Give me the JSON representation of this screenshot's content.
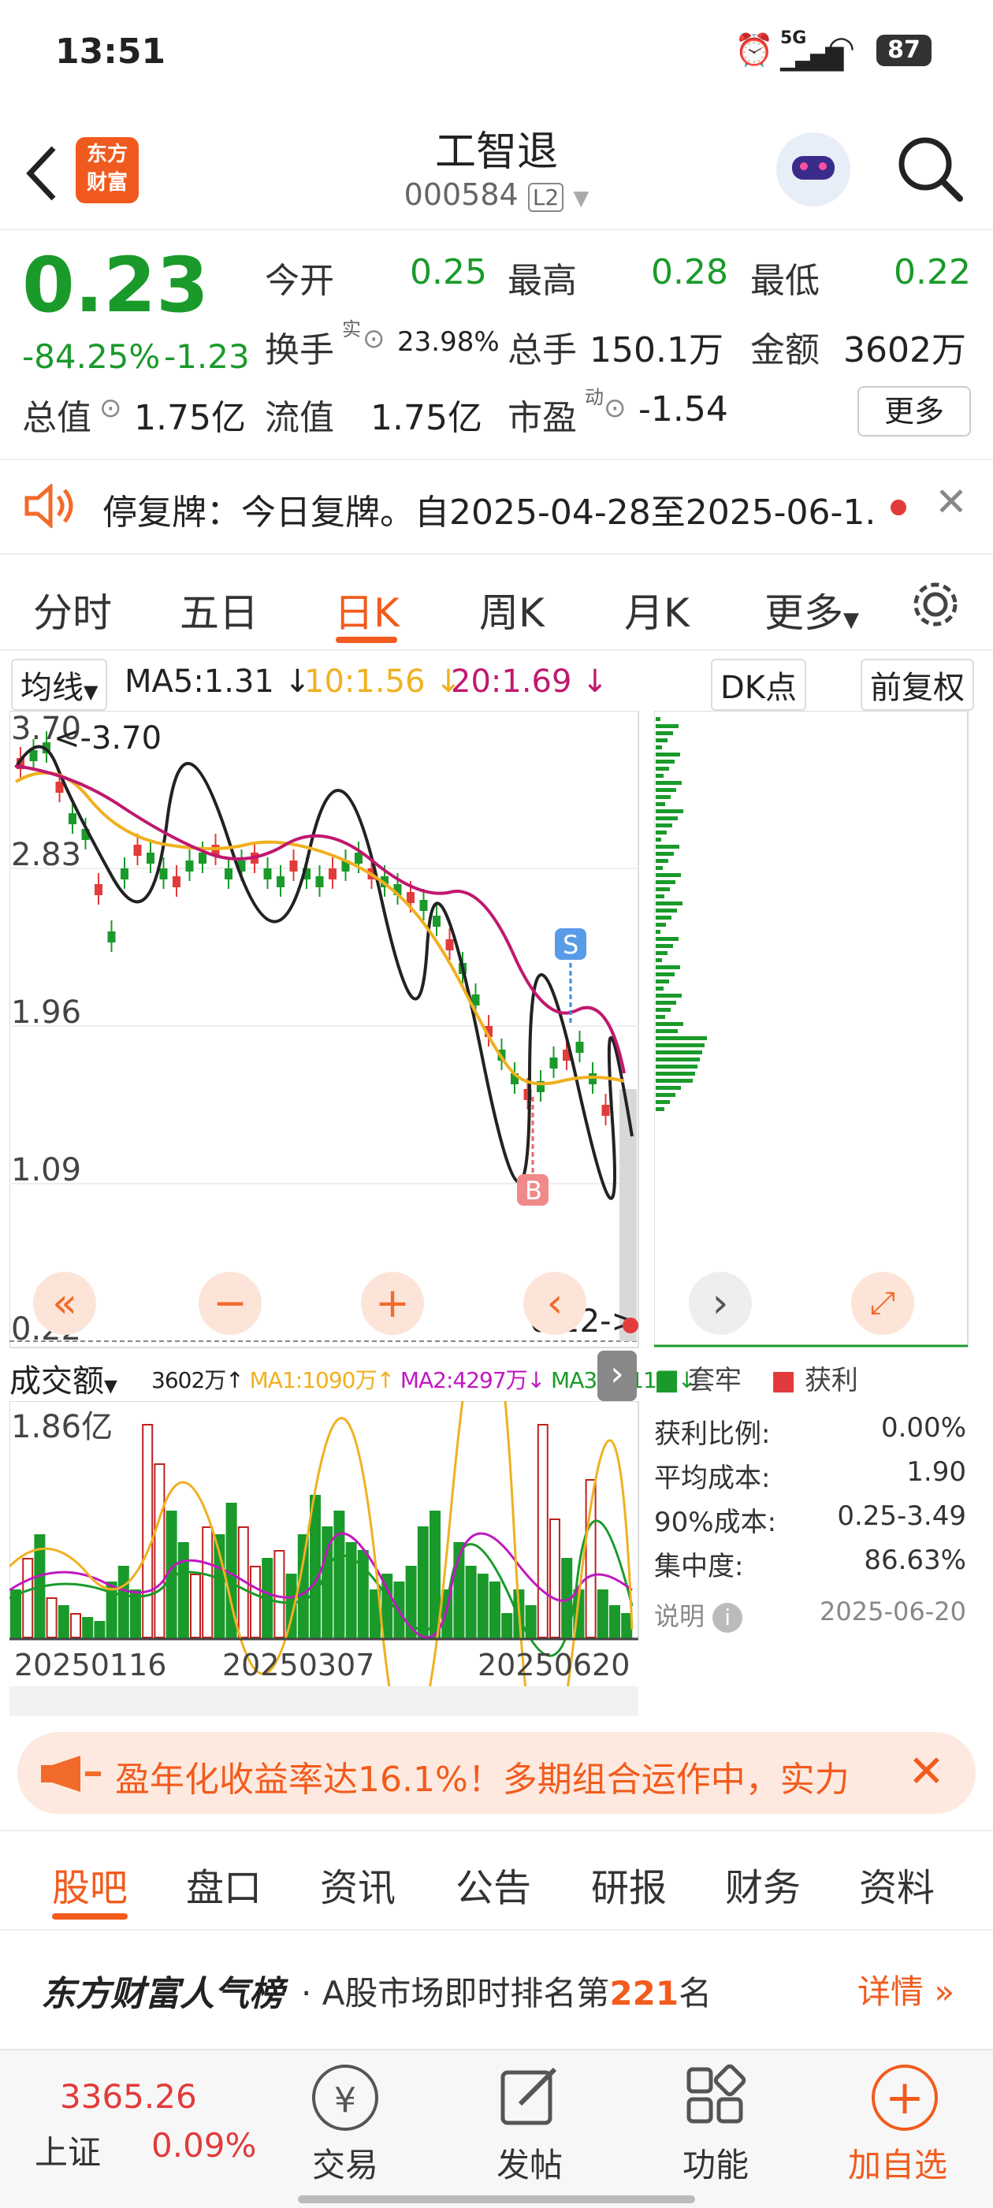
{
  "status": {
    "time": "13:51",
    "signal": "5G",
    "battery": "87"
  },
  "header": {
    "title": "工智退",
    "code": "000584",
    "level": "L2",
    "logo_line1": "东方",
    "logo_line2": "财富"
  },
  "quote": {
    "price": "0.23",
    "change_pct": "-84.25%",
    "change": "-1.23",
    "open_label": "今开",
    "open": "0.25",
    "high_label": "最高",
    "high": "0.28",
    "low_label": "最低",
    "low": "0.22",
    "turnover_label": "换手",
    "turnover_sup": "实",
    "turnover": "23.98%",
    "volume_label": "总手",
    "volume": "150.1万",
    "amount_label": "金额",
    "amount": "3602万",
    "mktcap_label": "总值",
    "mktcap": "1.75亿",
    "float_label": "流值",
    "float": "1.75亿",
    "pe_label": "市盈",
    "pe_sup": "动",
    "pe": "-1.54",
    "more": "更多"
  },
  "notice": {
    "text": "停复牌：今日复牌。自2025-04-28至2025-06-1..."
  },
  "chart_tabs": {
    "items": [
      "分时",
      "五日",
      "日K",
      "周K",
      "月K"
    ],
    "more": "更多",
    "active": "日K"
  },
  "indicators": {
    "ma_label": "均线",
    "ma5": "MA5:1.31",
    "ma10": "10:1.56",
    "ma20": "20:1.69",
    "dk": "DK点",
    "adj": "前复权"
  },
  "kline": {
    "y_ticks": [
      "3.70",
      "2.83",
      "1.96",
      "1.09",
      "0.22"
    ],
    "max_label": "3.70",
    "last_label": "0.22",
    "s_badge": "S",
    "b_badge": "B"
  },
  "volume_panel": {
    "selector": "成交额",
    "total": "3602万",
    "ma1": "MA1:1090万",
    "ma2": "MA2:4297万",
    "ma3": "MA3:5111万",
    "max": "1.86亿",
    "dates": [
      "20250116",
      "20250307",
      "20250620"
    ]
  },
  "chips": {
    "legend_trapped": "套牢",
    "legend_profit": "获利",
    "rows": [
      {
        "label": "获利比例:",
        "value": "0.00%"
      },
      {
        "label": "平均成本:",
        "value": "1.90"
      },
      {
        "label": "90%成本:",
        "value": "0.25-3.49"
      },
      {
        "label": "集中度:",
        "value": "86.63%"
      }
    ],
    "note": "说明",
    "date": "2025-06-20"
  },
  "banner": {
    "text": "盈年化收益率达16.1%！多期组合运作中，实力"
  },
  "section_tabs": {
    "items": [
      "股吧",
      "盘口",
      "资讯",
      "公告",
      "研报",
      "财务",
      "资料"
    ],
    "active": "股吧"
  },
  "popularity": {
    "brand": "东方财富人气榜",
    "text_pre": "· A股市场即时排名第",
    "rank": "221",
    "text_post": "名",
    "detail": "详情"
  },
  "bottom_bar": {
    "index_value": "3365.26",
    "index_name": "上证",
    "index_pct": "0.09%",
    "trade": "交易",
    "post": "发帖",
    "func": "功能",
    "add": "加自选"
  },
  "chart_data": {
    "type": "candlestick",
    "ma_series": [
      {
        "name": "MA5",
        "color": "#222222",
        "last": 1.31
      },
      {
        "name": "MA10",
        "color": "#f0b020",
        "last": 1.56
      },
      {
        "name": "MA20",
        "color": "#c0186e",
        "last": 1.69
      }
    ],
    "ylim": [
      0.22,
      3.7
    ]
  },
  "colors": {
    "accent": "#f25b1d",
    "up": "#e23b3b",
    "down": "#1a9a2a"
  }
}
